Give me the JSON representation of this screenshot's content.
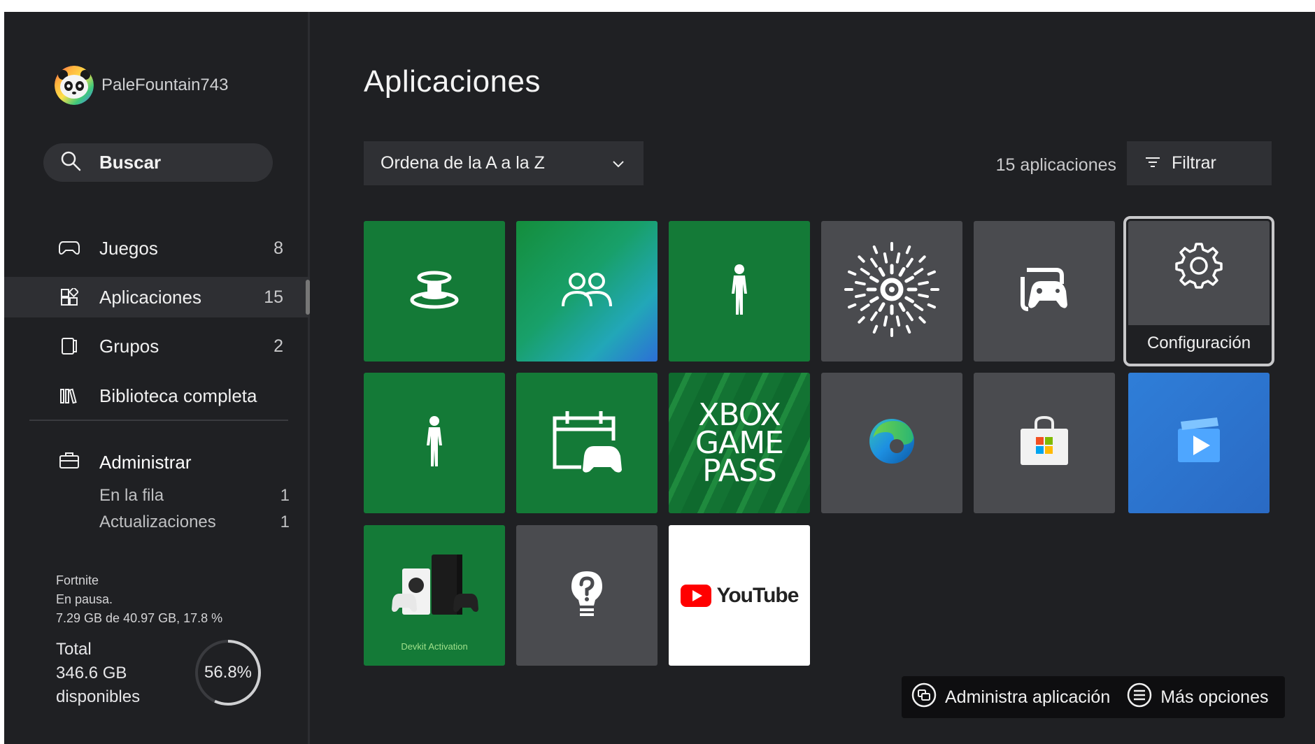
{
  "sidebar": {
    "gamertag": "PaleFountain743",
    "search_label": "Buscar",
    "nav": [
      {
        "label": "Juegos",
        "count": "8"
      },
      {
        "label": "Aplicaciones",
        "count": "15"
      },
      {
        "label": "Grupos",
        "count": "2"
      },
      {
        "label": "Biblioteca completa",
        "count": ""
      }
    ],
    "manage": {
      "label": "Administrar",
      "queue_label": "En la fila",
      "queue_count": "1",
      "updates_label": "Actualizaciones",
      "updates_count": "1"
    },
    "download": {
      "title": "Fortnite",
      "status": "En pausa.",
      "progress_text": "7.29 GB de 40.97 GB, 17.8 %",
      "progress": 0.178
    },
    "storage": {
      "total_label": "Total",
      "free": "346.6 GB",
      "free_label": "disponibles",
      "percent_text": "56.8%",
      "percent": 0.568
    }
  },
  "main": {
    "title": "Aplicaciones",
    "sort_label": "Ordena de la A a la Z",
    "app_count": "15 aplicaciones",
    "filter_label": "Filtrar",
    "focused_tile_caption": "Configuración",
    "tiles": [
      {
        "icon": "accessory-button-icon",
        "color": "#147a37"
      },
      {
        "icon": "people-icon",
        "color": "#1a9a6a"
      },
      {
        "icon": "avatar-figure-icon",
        "color": "#147a37"
      },
      {
        "icon": "sunburst-icon",
        "color": "#4a4b4f"
      },
      {
        "icon": "captures-gamepad-icon",
        "color": "#4a4b4f"
      },
      {
        "icon": "settings-gear-icon",
        "color": "#4a4b4f"
      },
      {
        "icon": "avatar-figure-icon",
        "color": "#147a37"
      },
      {
        "icon": "calendar-controller-icon",
        "color": "#147a37"
      },
      {
        "icon": "xbox-game-pass-logo",
        "color": "#0f6a2e"
      },
      {
        "icon": "edge-browser-icon",
        "color": "#4a4b4f"
      },
      {
        "icon": "store-bag-icon",
        "color": "#4a4b4f"
      },
      {
        "icon": "movies-tv-icon",
        "color": "#2e6fd0"
      },
      {
        "icon": "console-controller-icon",
        "color": "#147a37"
      },
      {
        "icon": "tips-lightbulb-icon",
        "color": "#4a4b4f"
      },
      {
        "icon": "youtube-logo",
        "color": "#ffffff"
      }
    ],
    "gamepass_lines": [
      "XBOX",
      "GAME",
      "PASS"
    ],
    "devkit_label": "Devkit Activation",
    "youtube_label": "YouTube"
  },
  "bottom_bar": {
    "manage_app_label": "Administra aplicación",
    "more_options_label": "Más opciones"
  }
}
